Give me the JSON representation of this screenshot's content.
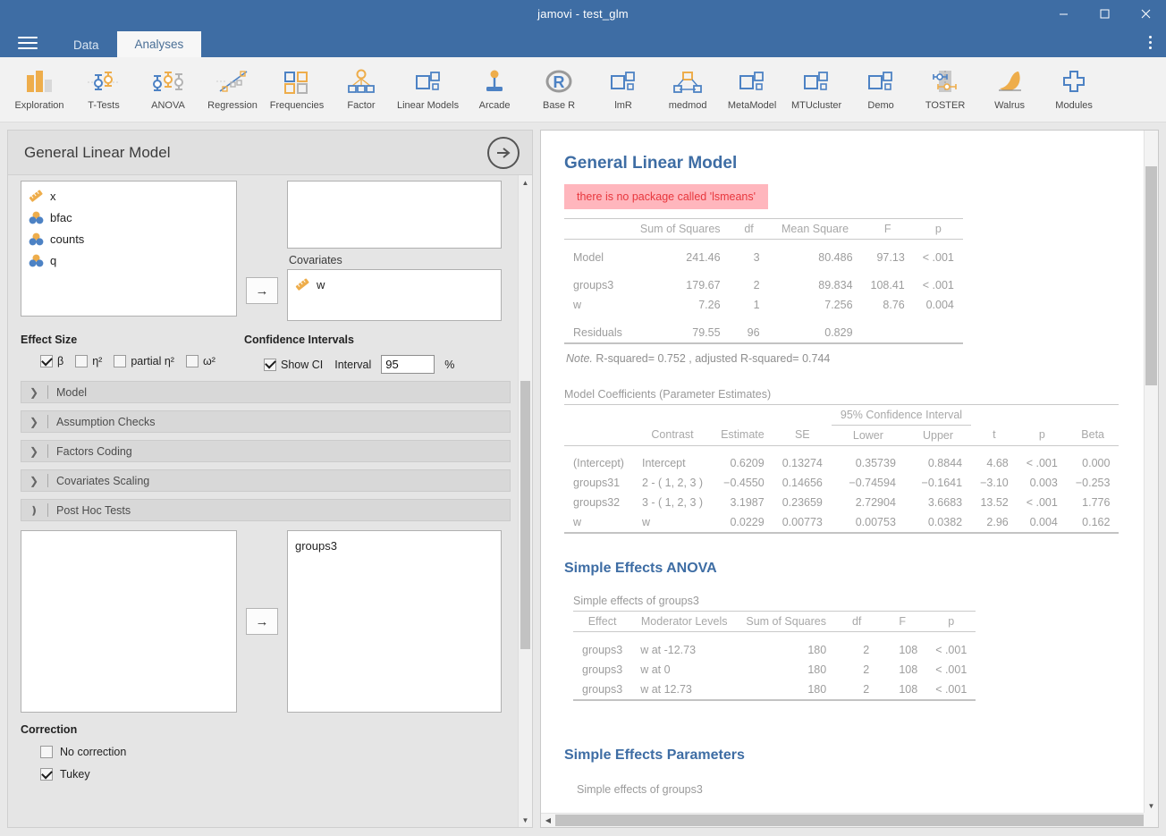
{
  "window": {
    "title": "jamovi - test_glm",
    "minimize_label": "minimize-icon",
    "maximize_label": "maximize-icon",
    "close_label": "close-icon"
  },
  "tabs": [
    {
      "label": "Data",
      "active": false
    },
    {
      "label": "Analyses",
      "active": true
    }
  ],
  "ribbon": [
    {
      "label": "Exploration",
      "icon": "exploration-icon"
    },
    {
      "label": "T-Tests",
      "icon": "t-tests-icon"
    },
    {
      "label": "ANOVA",
      "icon": "anova-icon"
    },
    {
      "label": "Regression",
      "icon": "regression-icon"
    },
    {
      "label": "Frequencies",
      "icon": "frequencies-icon"
    },
    {
      "label": "Factor",
      "icon": "factor-icon"
    },
    {
      "label": "Linear Models",
      "icon": "linear-models-icon"
    },
    {
      "label": "Arcade",
      "icon": "arcade-icon"
    },
    {
      "label": "Base R",
      "icon": "base-r-icon"
    },
    {
      "label": "lmR",
      "icon": "lmr-icon"
    },
    {
      "label": "medmod",
      "icon": "medmod-icon"
    },
    {
      "label": "MetaModel",
      "icon": "metamodel-icon"
    },
    {
      "label": "MTUcluster",
      "icon": "mtucluster-icon"
    },
    {
      "label": "Demo",
      "icon": "demo-icon"
    },
    {
      "label": "TOSTER",
      "icon": "toster-icon"
    },
    {
      "label": "Walrus",
      "icon": "walrus-icon"
    },
    {
      "label": "Modules",
      "icon": "modules-icon"
    }
  ],
  "options": {
    "title": "General Linear Model",
    "variables": [
      {
        "name": "x",
        "type": "continuous"
      },
      {
        "name": "bfac",
        "type": "nominal"
      },
      {
        "name": "counts",
        "type": "nominal"
      },
      {
        "name": "q",
        "type": "nominal"
      }
    ],
    "covariates_label": "Covariates",
    "covariates": [
      {
        "name": "w",
        "type": "continuous"
      }
    ],
    "transfer_arrow": "→",
    "effect_size": {
      "title": "Effect Size",
      "items": [
        {
          "label": "β",
          "checked": true
        },
        {
          "label": "η²",
          "checked": false
        },
        {
          "label": "partial η²",
          "checked": false
        },
        {
          "label": "ω²",
          "checked": false
        }
      ]
    },
    "confidence_intervals": {
      "title": "Confidence Intervals",
      "show_ci_label": "Show CI",
      "show_ci_checked": true,
      "interval_label": "Interval",
      "interval_value": "95",
      "percent_label": "%"
    },
    "sections": [
      {
        "label": "Model",
        "expanded": false
      },
      {
        "label": "Assumption Checks",
        "expanded": false
      },
      {
        "label": "Factors Coding",
        "expanded": false
      },
      {
        "label": "Covariates Scaling",
        "expanded": false
      },
      {
        "label": "Post Hoc Tests",
        "expanded": true
      }
    ],
    "post_hoc": {
      "selected": [
        "groups3"
      ]
    },
    "correction": {
      "title": "Correction",
      "items": [
        {
          "label": "No correction",
          "checked": false
        },
        {
          "label": "Tukey",
          "checked": true
        }
      ]
    }
  },
  "results": {
    "heading": "General Linear Model",
    "error": "there is no package called 'lsmeans'",
    "anova": {
      "columns": [
        "",
        "Sum of Squares",
        "df",
        "Mean Square",
        "F",
        "p"
      ],
      "rows": [
        {
          "label": "Model",
          "ss": "241.46",
          "df": "3",
          "ms": "80.486",
          "f": "97.13",
          "p": "< .001",
          "group_start": true
        },
        {
          "label": "groups3",
          "ss": "179.67",
          "df": "2",
          "ms": "89.834",
          "f": "108.41",
          "p": "< .001",
          "group_start": true
        },
        {
          "label": "w",
          "ss": "7.26",
          "df": "1",
          "ms": "7.256",
          "f": "8.76",
          "p": "0.004",
          "group_start": false
        },
        {
          "label": "Residuals",
          "ss": "79.55",
          "df": "96",
          "ms": "0.829",
          "f": "",
          "p": "",
          "group_start": true
        }
      ],
      "note": "R-squared= 0.752 , adjusted R-squared= 0.744",
      "note_prefix": "Note."
    },
    "coefficients": {
      "caption": "Model Coefficients (Parameter Estimates)",
      "ci_span_label": "95% Confidence Interval",
      "columns": [
        "",
        "Contrast",
        "Estimate",
        "SE",
        "Lower",
        "Upper",
        "t",
        "p",
        "Beta"
      ],
      "rows": [
        {
          "name": "(Intercept)",
          "contrast": "Intercept",
          "estimate": "0.6209",
          "se": "0.13274",
          "lower": "0.35739",
          "upper": "0.8844",
          "t": "4.68",
          "p": "< .001",
          "beta": "0.000"
        },
        {
          "name": "groups31",
          "contrast": "2 - ( 1, 2, 3 )",
          "estimate": "−0.4550",
          "se": "0.14656",
          "lower": "−0.74594",
          "upper": "−0.1641",
          "t": "−3.10",
          "p": "0.003",
          "beta": "−0.253"
        },
        {
          "name": "groups32",
          "contrast": "3 - ( 1, 2, 3 )",
          "estimate": "3.1987",
          "se": "0.23659",
          "lower": "2.72904",
          "upper": "3.6683",
          "t": "13.52",
          "p": "< .001",
          "beta": "1.776"
        },
        {
          "name": "w",
          "contrast": "w",
          "estimate": "0.0229",
          "se": "0.00773",
          "lower": "0.00753",
          "upper": "0.0382",
          "t": "2.96",
          "p": "0.004",
          "beta": "0.162"
        }
      ]
    },
    "simple_effects_anova": {
      "heading": "Simple Effects ANOVA",
      "caption": "Simple effects of groups3",
      "columns": [
        "Effect",
        "Moderator Levels",
        "Sum of Squares",
        "df",
        "F",
        "p"
      ],
      "rows": [
        {
          "effect": "groups3",
          "moderator": "w at -12.73",
          "ss": "180",
          "df": "2",
          "f": "108",
          "p": "< .001"
        },
        {
          "effect": "groups3",
          "moderator": "w at 0",
          "ss": "180",
          "df": "2",
          "f": "108",
          "p": "< .001"
        },
        {
          "effect": "groups3",
          "moderator": "w at 12.73",
          "ss": "180",
          "df": "2",
          "f": "108",
          "p": "< .001"
        }
      ]
    },
    "simple_effects_parameters": {
      "heading": "Simple Effects Parameters",
      "caption": "Simple effects of groups3"
    }
  },
  "colors": {
    "brand_blue": "#3e6da4",
    "heading_blue": "#3e6da4",
    "error_bg": "#ffb6bd",
    "error_text": "#e8373d",
    "icon_orange": "#eead4b",
    "icon_blue": "#4d82c4",
    "table_text": "#9d9d9d"
  }
}
